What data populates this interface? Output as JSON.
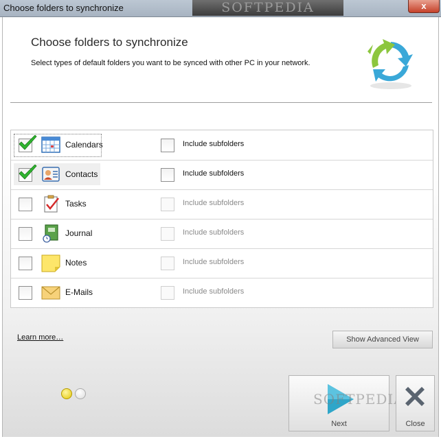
{
  "window": {
    "title": "Choose folders to synchronize",
    "watermark": "SOFTPEDIA",
    "close_glyph": "x"
  },
  "header": {
    "title": "Choose folders to synchronize",
    "subtitle": "Select types of default folders you want to be synced with other PC in your network.",
    "logo_icon": "sync-arrows-icon"
  },
  "folders": [
    {
      "label": "Calendars",
      "icon": "calendar-icon",
      "checked": true,
      "subfolders_label": "Include subfolders",
      "subfolders_enabled": true,
      "subfolders_checked": false
    },
    {
      "label": "Contacts",
      "icon": "contact-card-icon",
      "checked": true,
      "subfolders_label": "Include subfolders",
      "subfolders_enabled": true,
      "subfolders_checked": false
    },
    {
      "label": "Tasks",
      "icon": "tasks-clipboard-icon",
      "checked": false,
      "subfolders_label": "Include subfolders",
      "subfolders_enabled": false,
      "subfolders_checked": false
    },
    {
      "label": "Journal",
      "icon": "journal-icon",
      "checked": false,
      "subfolders_label": "Include subfolders",
      "subfolders_enabled": false,
      "subfolders_checked": false
    },
    {
      "label": "Notes",
      "icon": "notes-icon",
      "checked": false,
      "subfolders_label": "Include subfolders",
      "subfolders_enabled": false,
      "subfolders_checked": false
    },
    {
      "label": "E-Mails",
      "icon": "envelope-icon",
      "checked": false,
      "subfolders_label": "Include subfolders",
      "subfolders_enabled": false,
      "subfolders_checked": false
    }
  ],
  "footer": {
    "learn_more": "Learn more…",
    "advanced_button": "Show Advanced View",
    "next_button": "Next",
    "close_button": "Close",
    "next_watermark": "SOFTPEDIA",
    "page_indicator": {
      "current": 1,
      "total": 2
    }
  },
  "colors": {
    "check_green": "#2fb52f",
    "next_arrow": "#2fa6c9",
    "close_x": "#5a6470",
    "active_dot": "#e3c80a",
    "logo_green": "#8cc63e",
    "logo_blue": "#3aa8d8"
  }
}
